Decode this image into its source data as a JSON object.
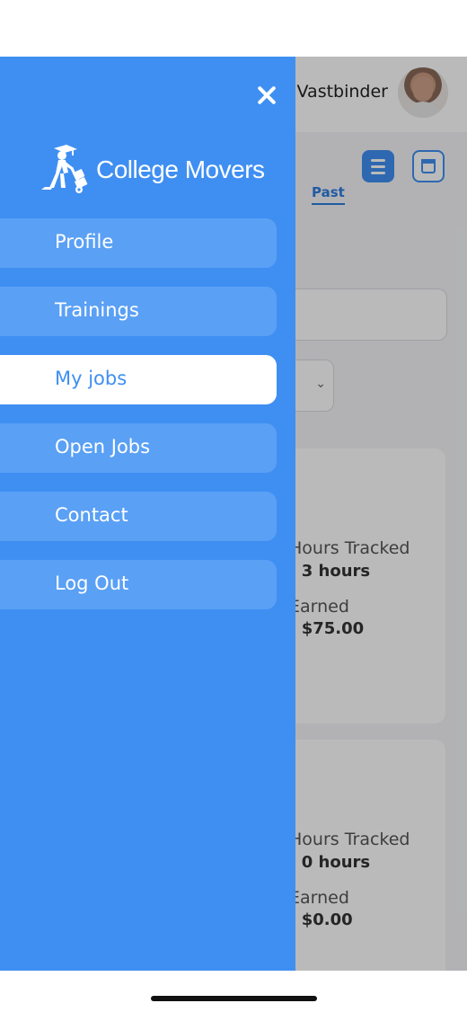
{
  "header": {
    "user_name": "Vastbinder"
  },
  "tabs": {
    "past_label": "Past"
  },
  "jobs": [
    {
      "hours_label": "Hours Tracked",
      "hours_value": "- 3 hours",
      "earned_label": "Earned",
      "earned_value": "- $75.00"
    },
    {
      "hours_label": "Hours Tracked",
      "hours_value": "- 0 hours",
      "earned_label": "Earned",
      "earned_value": "- $0.00"
    }
  ],
  "drawer": {
    "brand_name": "College Movers",
    "items": [
      {
        "label": "Profile"
      },
      {
        "label": "Trainings"
      },
      {
        "label": "My jobs",
        "active": true
      },
      {
        "label": "Open Jobs"
      },
      {
        "label": "Contact"
      },
      {
        "label": "Log Out"
      }
    ]
  },
  "icons": {
    "close": "close-icon",
    "brand": "mover-dolly-icon",
    "list_view": "list-icon",
    "calendar_view": "calendar-icon",
    "select": "chevron-down-icon"
  },
  "colors": {
    "primary": "#3f8ff2",
    "nav_item_bg": "#5aa0f5",
    "active_bg": "#ffffff"
  }
}
